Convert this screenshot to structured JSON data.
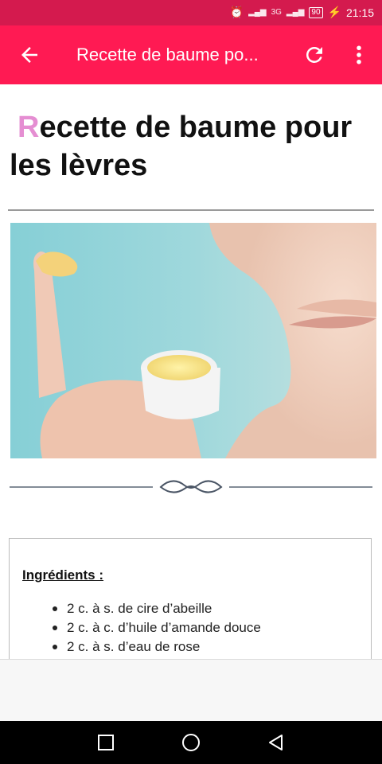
{
  "status_bar": {
    "time": "21:15",
    "battery": "90",
    "network": "3G"
  },
  "app_bar": {
    "title": "Recette de baume po...",
    "icons": [
      "arrow-back-icon",
      "refresh-icon",
      "more-vert-icon"
    ]
  },
  "article": {
    "title_first_letter": "R",
    "title_rest": "ecette de baume pour les lèvres",
    "image": "woman-applying-lip-balm-photo",
    "ingredients_heading": "Ingrédients :",
    "ingredients": [
      "2 c. à s. de cire d’abeille",
      "2 c. à c. d’huile d’amande douce",
      "2 c. à s. d’eau de rose"
    ]
  },
  "colors": {
    "status_bar": "#d41a4e",
    "app_bar": "#ff1a53",
    "title_accent": "#e58ed2"
  }
}
